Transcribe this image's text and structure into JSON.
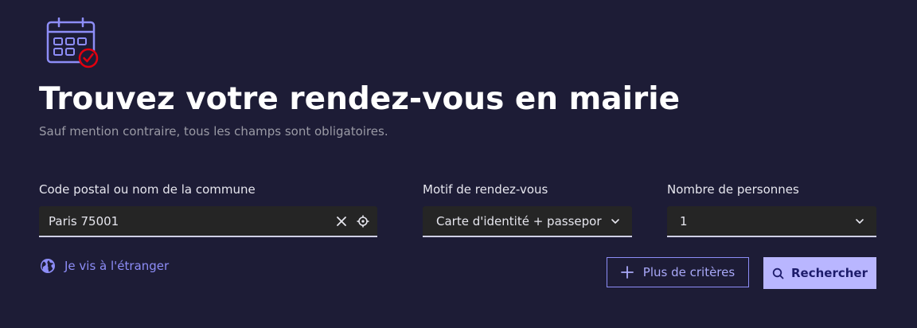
{
  "header": {
    "illustration_icon": "calendar-check-icon",
    "title": "Trouvez votre rendez-vous en mairie",
    "subtitle": "Sauf mention contraire, tous les champs sont obligatoires."
  },
  "form": {
    "commune": {
      "label": "Code postal ou nom de la commune",
      "value": "Paris 75001",
      "clear_icon": "close-icon",
      "locate_icon": "crosshair-icon"
    },
    "motif": {
      "label": "Motif de rendez-vous",
      "selected": "Carte d'identité + passeport",
      "icon": "chevron-down-icon"
    },
    "personnes": {
      "label": "Nombre de personnes",
      "selected": "1",
      "icon": "chevron-down-icon"
    }
  },
  "actions": {
    "abroad_link": "Je vis à l'étranger",
    "abroad_icon": "globe-icon",
    "more_criteria": "Plus de critères",
    "more_icon": "plus-icon",
    "search": "Rechercher",
    "search_icon": "search-icon"
  },
  "colors": {
    "background": "#1d1c36",
    "accent": "#8d8df7",
    "primary_button": "#b9b6ff",
    "field_background": "#252525",
    "alert_red": "#e1000f"
  }
}
